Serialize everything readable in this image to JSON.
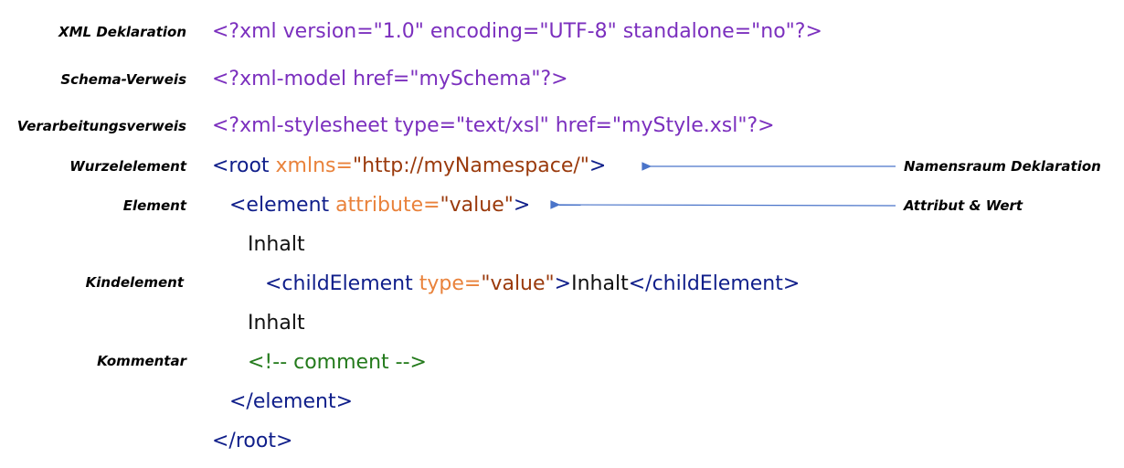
{
  "labels": {
    "xml_declaration": "XML Deklaration",
    "schema_reference": "Schema-Verweis",
    "processing_reference": "Verarbeitungsverweis",
    "root_element": "Wurzelelement",
    "element": "Element",
    "child_element": "Kindelement",
    "comment": "Kommentar"
  },
  "callouts": {
    "namespace_declaration": "Namensraum Deklaration",
    "attribute_value": "Attribut & Wert"
  },
  "code": {
    "xml_decl": "<?xml version=\"1.0\" encoding=\"UTF-8\" standalone=\"no\"?>",
    "xml_model": "<?xml-model href=\"mySchema\"?>",
    "xml_stylesheet": "<?xml-stylesheet type=\"text/xsl\" href=\"myStyle.xsl\"?>",
    "root_open": "<root",
    "root_attr": " xmlns=",
    "root_value": "\"http://myNamespace/\"",
    "root_close": ">",
    "element_open": "<element",
    "element_attr": " attribute=",
    "element_value": "\"value\"",
    "element_close": ">",
    "content_1": "Inhalt",
    "child_open": "<childElement",
    "child_attr": " type=",
    "child_value": "\"value\"",
    "child_close_bracket": ">",
    "child_text": "Inhalt",
    "child_end": "</childElement>",
    "content_2": "Inhalt",
    "comment": "<!-- comment -->",
    "element_end": "</element>",
    "root_end": "</root>"
  },
  "colors": {
    "processing_instruction": "#7b2fbe",
    "tag": "#0f1e8a",
    "attribute": "#e9823b",
    "attribute_value": "#9a3a0c",
    "text": "#111111",
    "comment": "#237a1b",
    "arrow": "#4a74c9"
  }
}
